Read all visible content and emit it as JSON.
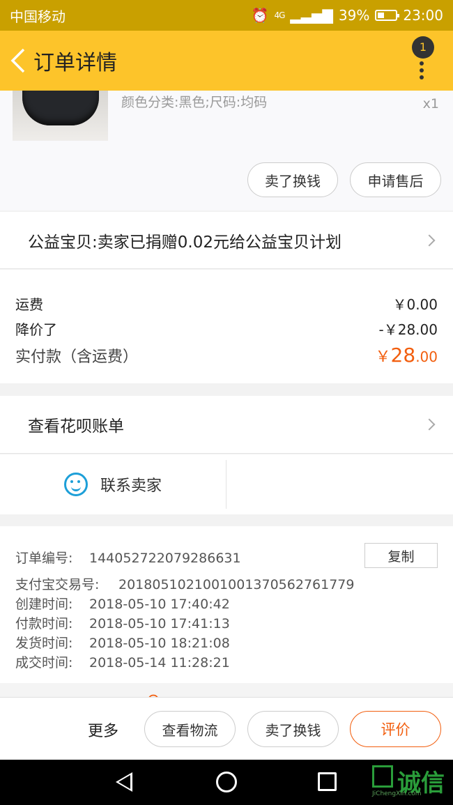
{
  "status_bar": {
    "carrier": "中国移动",
    "network": "4G",
    "battery": "39%",
    "time": "23:00"
  },
  "header": {
    "title": "订单详情",
    "notification_count": "1"
  },
  "product": {
    "sku": "颜色分类:黑色;尺码:均码",
    "quantity": "x1",
    "sell_button": "卖了换钱",
    "after_sale_button": "申请售后"
  },
  "charity": {
    "text": "公益宝贝:卖家已捐赠0.02元给公益宝贝计划"
  },
  "fees": {
    "shipping_label": "运费",
    "shipping_value": "￥0.00",
    "discount_label": "降价了",
    "discount_value": "-￥28.00",
    "paid_label": "实付款（含运费）",
    "paid_currency": "￥",
    "paid_int": "28",
    "paid_dec": ".00"
  },
  "huabei": {
    "text": "查看花呗账单"
  },
  "contact": {
    "label": "联系卖家"
  },
  "order_info": {
    "copy_button": "复制",
    "order_no_label": "订单编号:",
    "order_no": "144052722079286631",
    "alipay_label": "支付宝交易号:",
    "alipay_no": "2018051021001001370562761779",
    "created_label": "创建时间:",
    "created": "2018-05-10 17:40:42",
    "paid_label": "付款时间:",
    "paid": "2018-05-10 17:41:13",
    "shipped_label": "发货时间:",
    "shipped": "2018-05-10 18:21:08",
    "completed_label": "成交时间:",
    "completed": "2018-05-14 11:28:21"
  },
  "bottom_bar": {
    "more": "更多",
    "logistics": "查看物流",
    "sell": "卖了换钱",
    "review": "评价"
  },
  "watermark": {
    "brand": "诚信",
    "url": "JiChengXin.com"
  },
  "colors": {
    "header": "#fdc42a",
    "status_bar": "#c9a000",
    "accent": "#f25e0e",
    "contact_icon": "#1d9fd8"
  }
}
